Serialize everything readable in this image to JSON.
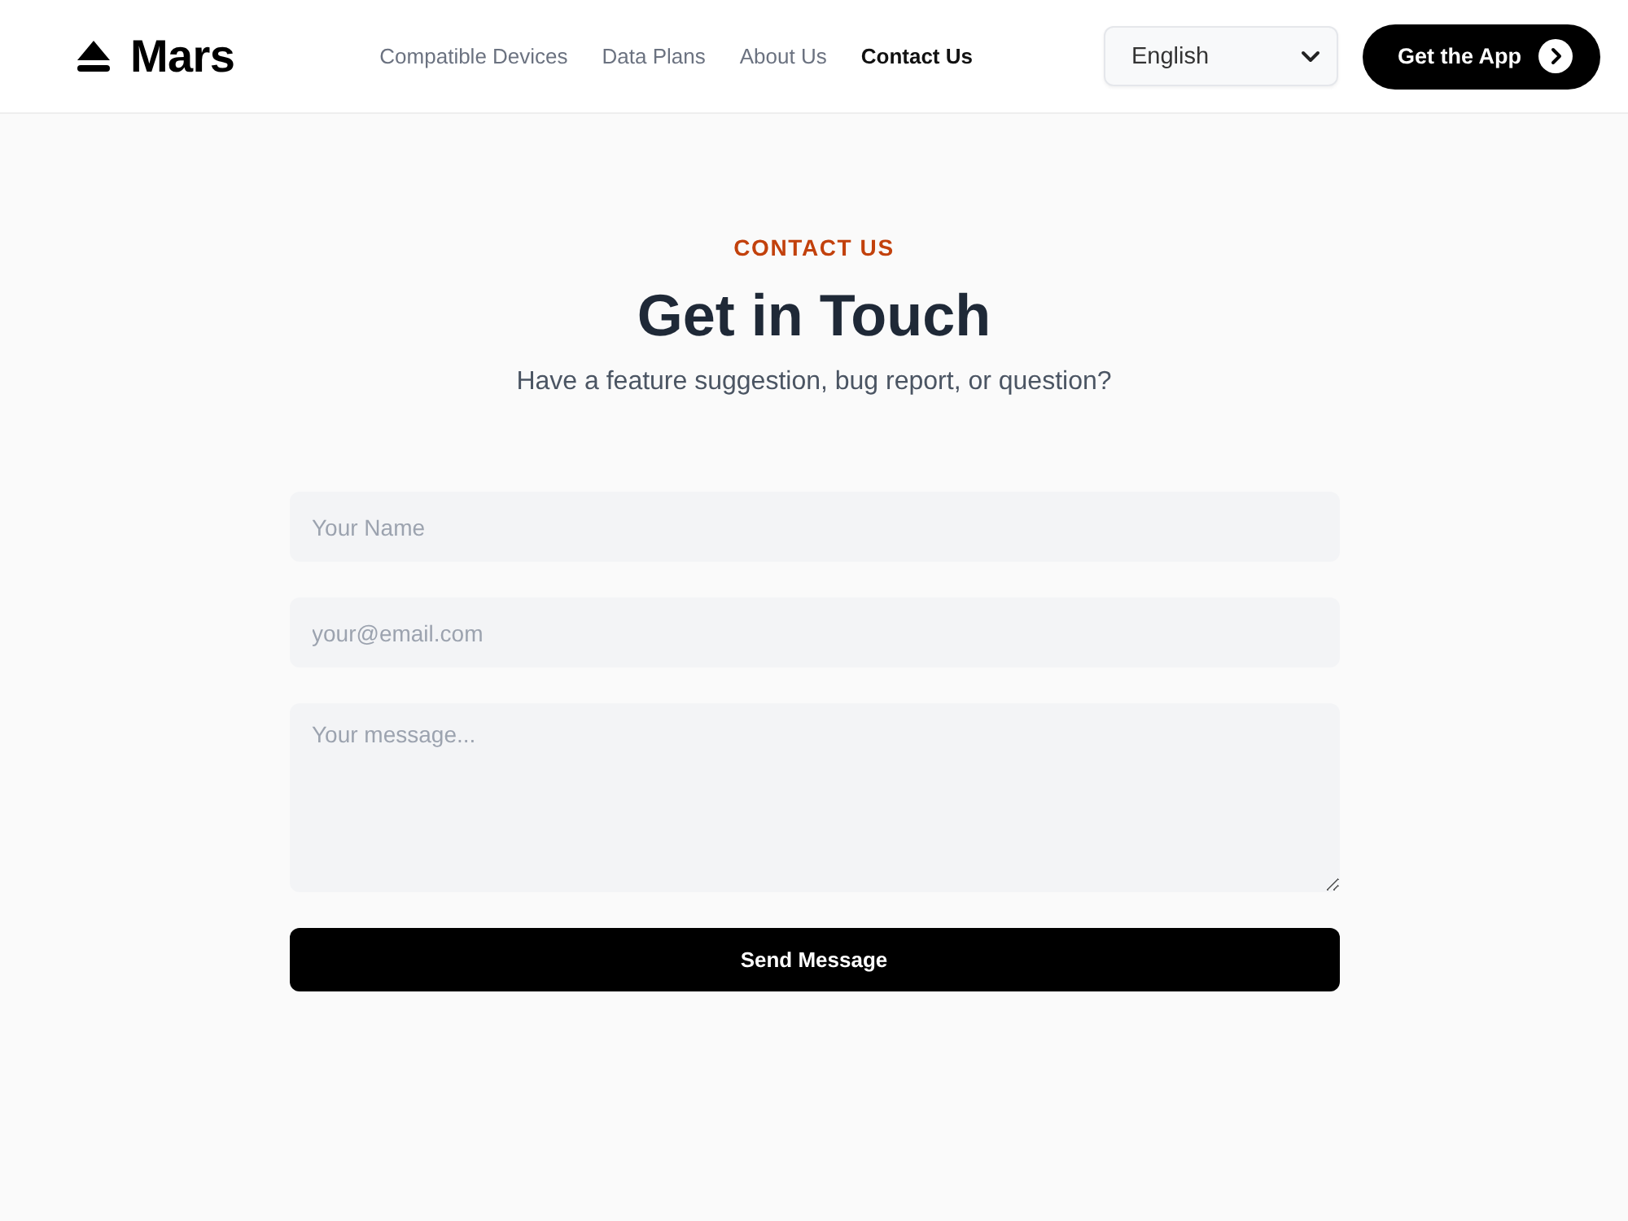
{
  "header": {
    "logo": "Mars",
    "nav": [
      {
        "label": "Compatible Devices",
        "selected": false
      },
      {
        "label": "Data Plans",
        "selected": false
      },
      {
        "label": "About Us",
        "selected": false
      },
      {
        "label": "Contact Us",
        "selected": true
      }
    ],
    "language": {
      "value": "English"
    },
    "cta": "Get the App"
  },
  "hero": {
    "eyebrow": "CONTACT US",
    "title": "Get in Touch",
    "subtitle": "Have a feature suggestion, bug report, or question?"
  },
  "form": {
    "fields": [
      {
        "kind": "input",
        "placeholder": "Your Name"
      },
      {
        "kind": "input",
        "placeholder": "your@email.com"
      },
      {
        "kind": "textarea",
        "placeholder": "Your message..."
      }
    ],
    "submit": "Send Message"
  }
}
